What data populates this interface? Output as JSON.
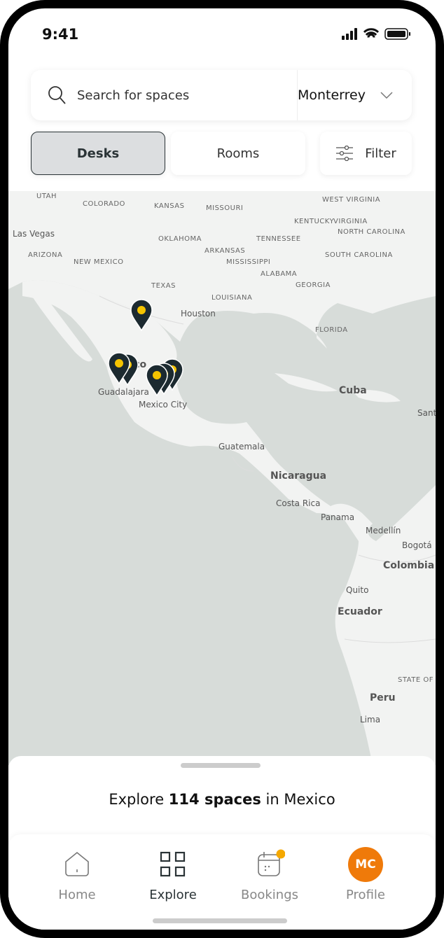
{
  "status": {
    "time": "9:41"
  },
  "search": {
    "placeholder": "Search for spaces",
    "location": "Monterrey"
  },
  "tabs": [
    {
      "label": "Desks",
      "active": true
    },
    {
      "label": "Rooms",
      "active": false
    }
  ],
  "filter": {
    "label": "Filter"
  },
  "map": {
    "land_color": "#f2f3f2",
    "water_color": "#d7dcd9",
    "pin_color": "#1c2a30",
    "pin_dot_color": "#f5c400",
    "labels": [
      "UTAH",
      "COLORADO",
      "KANSAS",
      "MISSOURI",
      "WEST VIRGINIA",
      "KENTUCKY",
      "VIRGINIA",
      "Las Vegas",
      "OKLAHOMA",
      "TENNESSEE",
      "NORTH CAROLINA",
      "ARIZONA",
      "NEW MEXICO",
      "ARKANSAS",
      "MISSISSIPPI",
      "SOUTH CAROLINA",
      "ALABAMA",
      "GEORGIA",
      "TEXAS",
      "LOUISIANA",
      "Houston",
      "FLORIDA",
      "Mexico",
      "Guadalajara",
      "Mexico City",
      "Cuba",
      "Santo Domingo",
      "Guatemala",
      "Nicaragua",
      "Costa Rica",
      "Panama",
      "Medellín",
      "Bogotá",
      "Colombia",
      "Quito",
      "Ecuador",
      "STATE OF",
      "Peru",
      "Lima"
    ]
  },
  "summary": {
    "prefix": "Explore ",
    "count": "114 spaces",
    "suffix": " in Mexico"
  },
  "nav": [
    {
      "label": "Home",
      "icon": "home-icon"
    },
    {
      "label": "Explore",
      "icon": "grid-icon",
      "active": true
    },
    {
      "label": "Bookings",
      "icon": "calendar-icon",
      "badge": true
    },
    {
      "label": "Profile",
      "icon": "avatar",
      "initials": "MC"
    }
  ],
  "accent": "#f07a0a"
}
